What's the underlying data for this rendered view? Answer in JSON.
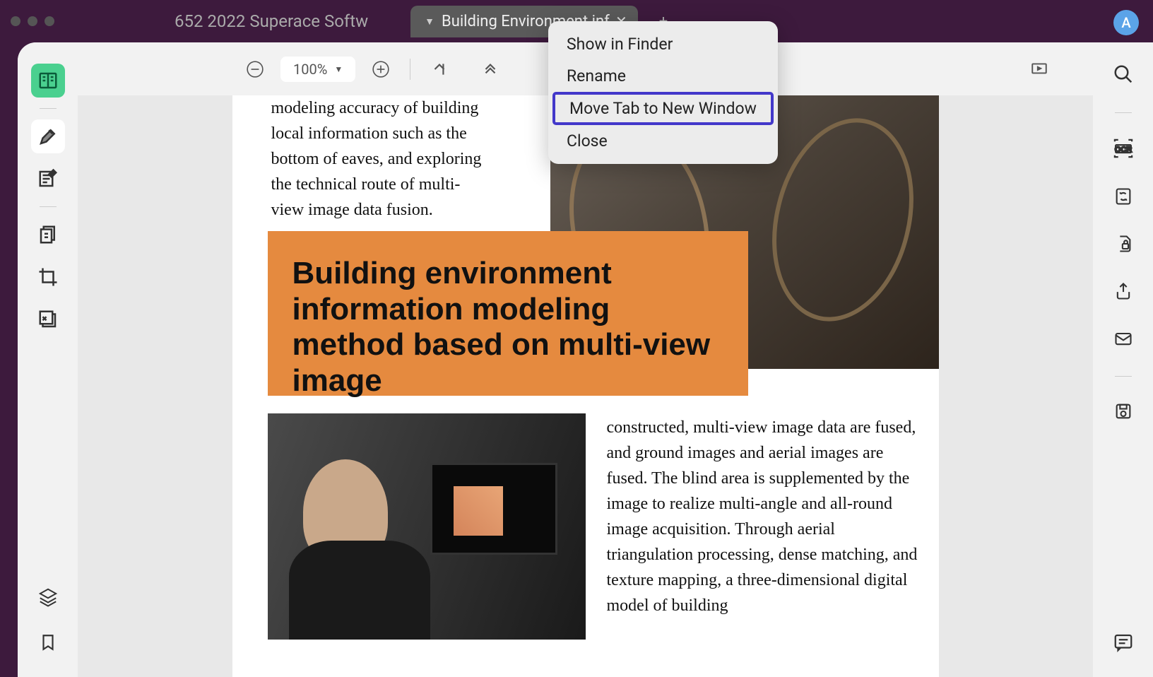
{
  "titlebar": {
    "left_title": "652  2022  Superace Softw",
    "tab_title": "Building Environment inf",
    "avatar_letter": "A"
  },
  "toolbar": {
    "zoom": "100%"
  },
  "context_menu": {
    "items": [
      "Show in Finder",
      "Rename",
      "Move Tab to New Window",
      "Close"
    ]
  },
  "document": {
    "frag1": "modeling accuracy of building local information such as the bottom of eaves, and exploring the technical route of multi-view image data fusion.",
    "heading": "Building environment information modeling method based on multi-view image",
    "frag2": "constructed, multi-view image data are fused, and ground images and aerial images are fused. The blind area is supplemented by the image to realize multi-angle and all-round image acquisition. Through aerial triangulation processing, dense matching, and texture mapping, a three-dimensional digital model of building"
  }
}
